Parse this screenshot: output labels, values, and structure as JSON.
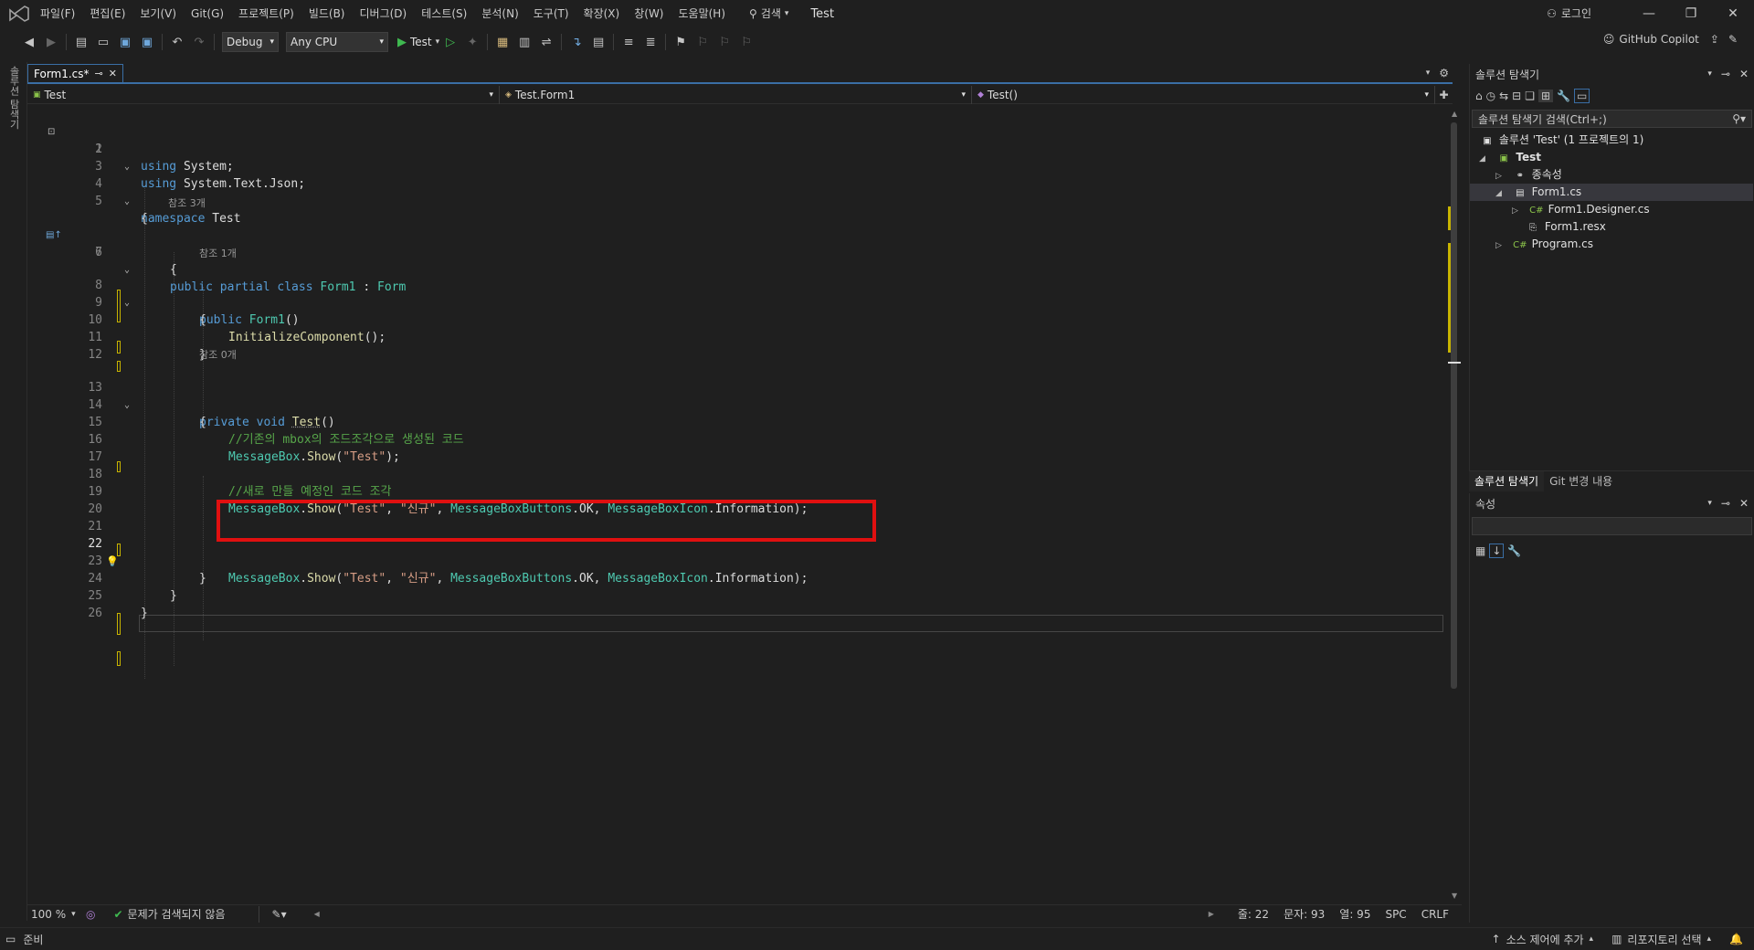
{
  "menu": {
    "items": [
      "파일(F)",
      "편집(E)",
      "보기(V)",
      "Git(G)",
      "프로젝트(P)",
      "빌드(B)",
      "디버그(D)",
      "테스트(S)",
      "분석(N)",
      "도구(T)",
      "확장(X)",
      "창(W)",
      "도움말(H)"
    ],
    "search_label": "검색",
    "solution_name": "Test",
    "login_label": "로그인"
  },
  "toolbar": {
    "config": "Debug",
    "platform": "Any CPU",
    "run_label": "Test",
    "copilot_label": "GitHub Copilot"
  },
  "left_rail": {
    "label": "솔루션 탐색기"
  },
  "editor": {
    "tab_label": "Form1.cs*",
    "nav_project": "Test",
    "nav_class": "Test.Form1",
    "nav_member": "Test()",
    "lines": [
      {
        "n": "1",
        "text": "using System.Text.Json;"
      },
      {
        "n": "2",
        "text": "using System;"
      },
      {
        "n": "3",
        "text": ""
      },
      {
        "n": "4",
        "text": "namespace Test"
      },
      {
        "n": "5",
        "text": "{"
      },
      {
        "n": "6",
        "text": "public partial class Form1 : Form",
        "lens": "참조 3개"
      },
      {
        "n": "7",
        "text": "{"
      },
      {
        "n": "8",
        "text": "public Form1()",
        "lens": "참조 1개"
      },
      {
        "n": "9",
        "text": "{"
      },
      {
        "n": "10",
        "text": "InitializeComponent();"
      },
      {
        "n": "11",
        "text": "}"
      },
      {
        "n": "12",
        "text": ""
      },
      {
        "n": "13",
        "text": "private void Test()",
        "lens": "참조 0개"
      },
      {
        "n": "14",
        "text": "{"
      },
      {
        "n": "15",
        "text": "//기존의 mbox의 조드조각으로 생성된 코드"
      },
      {
        "n": "16",
        "text": "MessageBox.Show(\"Test\");"
      },
      {
        "n": "17",
        "text": ""
      },
      {
        "n": "18",
        "text": "//새로 만들 예정인 코드 조각"
      },
      {
        "n": "19",
        "text": "MessageBox.Show(\"Test\", \"신규\", MessageBoxButtons.OK, MessageBoxIcon.Information);"
      },
      {
        "n": "20",
        "text": ""
      },
      {
        "n": "21",
        "text": ""
      },
      {
        "n": "22",
        "text": "MessageBox.Show(\"Test\", \"신규\", MessageBoxButtons.OK, MessageBoxIcon.Information);"
      },
      {
        "n": "23",
        "text": "}"
      },
      {
        "n": "24",
        "text": "}"
      },
      {
        "n": "25",
        "text": "}"
      },
      {
        "n": "26",
        "text": ""
      }
    ],
    "current_line": "22"
  },
  "editor_status": {
    "zoom": "100 %",
    "issues": "문제가 검색되지 않음",
    "line": "줄: 22",
    "char": "문자: 93",
    "col": "열: 95",
    "whitespace": "SPC",
    "eol": "CRLF"
  },
  "solution_explorer": {
    "title": "솔루션 탐색기",
    "search_placeholder": "솔루션 탐색기 검색(Ctrl+;)",
    "items": [
      {
        "label": "솔루션 'Test' (1 프로젝트의 1)",
        "icon": "solution-icon"
      },
      {
        "label": "Test",
        "icon": "project-icon"
      },
      {
        "label": "종속성",
        "icon": "dependencies-icon"
      },
      {
        "label": "Form1.cs",
        "icon": "form-icon"
      },
      {
        "label": "Form1.Designer.cs",
        "icon": "csharp-file-icon"
      },
      {
        "label": "Form1.resx",
        "icon": "resx-file-icon"
      },
      {
        "label": "Program.cs",
        "icon": "csharp-file-icon"
      }
    ],
    "tabs": [
      "솔루션 탐색기",
      "Git 변경 내용"
    ]
  },
  "properties": {
    "title": "속성"
  },
  "statusbar": {
    "ready": "준비",
    "source_control": "소스 제어에 추가",
    "repo": "리포지토리 선택"
  },
  "colors": {
    "accent": "#3a6ea5",
    "highlight_box": "#e01010",
    "keyword": "#569cd6",
    "type": "#4ec9b0",
    "string": "#d69d85",
    "comment": "#57a64a"
  }
}
